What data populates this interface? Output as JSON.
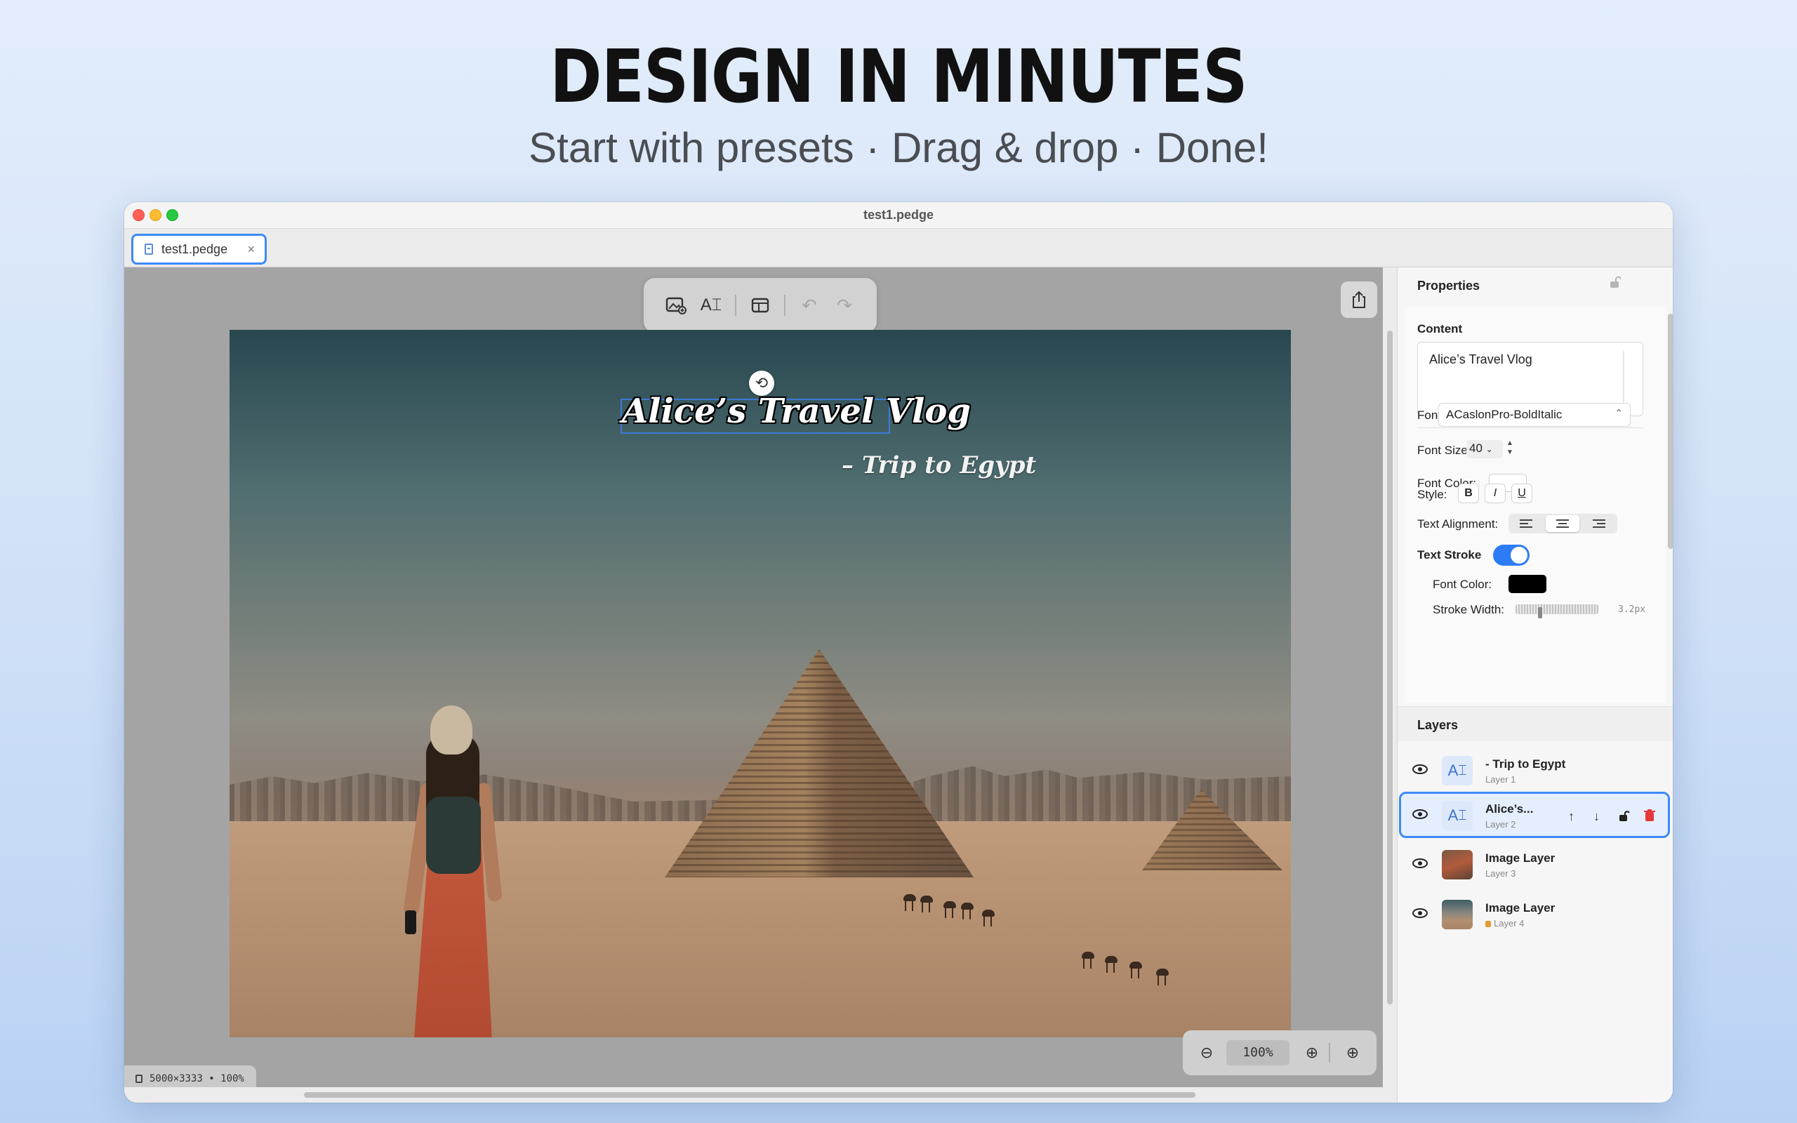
{
  "hero": {
    "title": "DESIGN IN MINUTES",
    "subtitle": "Start with presets · Drag & drop · Done!"
  },
  "window": {
    "title": "test1.pedge",
    "tab_label": "test1.pedge",
    "tab_close": "×"
  },
  "toolbar": {
    "add_image_icon": "image-plus",
    "add_text_icon": "text-cursor",
    "template_icon": "layout",
    "undo_icon": "↶",
    "redo_icon": "↷",
    "add_text_glyph": "A⌶",
    "template_glyph": "▤"
  },
  "artboard": {
    "title_text": "Alice’s Travel Vlog",
    "subtitle_text": "– Trip to Egypt",
    "rotate_glyph": "⟲"
  },
  "status": {
    "canvas_info": "5000×3333 • 100%"
  },
  "zoom": {
    "value": "100%",
    "zoom_out_glyph": "⊖",
    "zoom_in_glyph": "⊕",
    "zoom_fit_glyph": "⊕"
  },
  "properties": {
    "header": "Properties",
    "content_label": "Content",
    "content_value": "Alice’s Travel Vlog",
    "font_label": "Font:",
    "font_value": "ACaslonPro-BoldItalic",
    "font_size_label": "Font Size:",
    "font_size_value": "40",
    "font_color_label": "Font Color:",
    "font_color": "#ffffff",
    "style_label": "Style:",
    "style_bold": "B",
    "style_italic": "I",
    "style_underline": "U",
    "alignment_label": "Text Alignment:",
    "alignment_selected": "center",
    "stroke_label": "Text Stroke",
    "stroke_enabled": true,
    "stroke_color_label": "Font Color:",
    "stroke_color": "#000000",
    "stroke_width_label": "Stroke Width:",
    "stroke_width_value": "3.2px"
  },
  "layers": {
    "header": "Layers",
    "items": [
      {
        "name": "- Trip to Egypt",
        "sub": "Layer 1",
        "type": "text",
        "selected": false,
        "locked": false
      },
      {
        "name": "Alice’s...",
        "sub": "Layer 2",
        "type": "text",
        "selected": true,
        "locked": false
      },
      {
        "name": "Image Layer",
        "sub": "Layer 3",
        "type": "image",
        "selected": false,
        "locked": false
      },
      {
        "name": "Image Layer",
        "sub": "Layer 4",
        "type": "image",
        "selected": false,
        "locked": true
      }
    ],
    "actions": {
      "up": "↑",
      "down": "↓",
      "lock": "🔓",
      "delete": "🗑"
    }
  },
  "colors": {
    "accent": "#3d8af7",
    "toggle_on": "#2d7cf6",
    "delete": "#e5383b"
  }
}
